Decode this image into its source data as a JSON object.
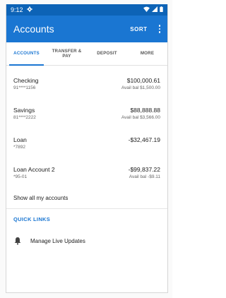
{
  "status_bar": {
    "time": "9:12",
    "icons": [
      "settings-gear-icon",
      "wifi-icon",
      "signal-icon",
      "battery-icon"
    ]
  },
  "app_bar": {
    "title": "Accounts",
    "sort_label": "SORT",
    "overflow_icon": "more-vert-icon"
  },
  "tabs": [
    {
      "label": "ACCOUNTS",
      "active": true
    },
    {
      "label": "TRANSFER & PAY",
      "active": false
    },
    {
      "label": "DEPOSIT",
      "active": false
    },
    {
      "label": "MORE",
      "active": false
    }
  ],
  "accounts": [
    {
      "name": "Checking",
      "number": "91****1156",
      "balance": "$100,000.61",
      "available": "Avail bal $1,500.00"
    },
    {
      "name": "Savings",
      "number": "81****2222",
      "balance": "$88,888.88",
      "available": "Avail bal $3,566.00"
    },
    {
      "name": "Loan",
      "number": "*7892",
      "balance": "-$32,467.19",
      "available": ""
    },
    {
      "name": "Loan Account 2",
      "number": "*95-01",
      "balance": "-$99,837.22",
      "available": "Avail bal -$9.11"
    }
  ],
  "show_all_label": "Show all my accounts",
  "quick_links": {
    "header": "QUICK LINKS",
    "items": [
      {
        "label": "Manage Live Updates",
        "icon": "bell-icon"
      }
    ]
  },
  "colors": {
    "primary": "#1a76d2",
    "status_bar": "#0d63b6",
    "text": "#212121",
    "secondary_text": "#666666"
  }
}
